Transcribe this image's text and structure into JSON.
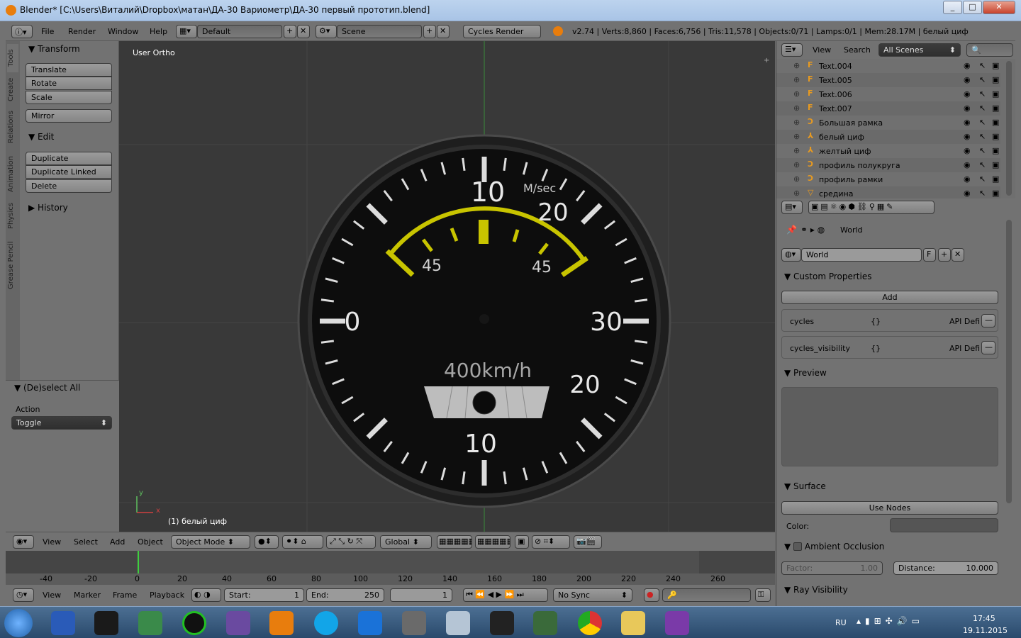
{
  "window": {
    "title": "Blender* [C:\\Users\\Виталий\\Dropbox\\матан\\ДА-30 Вариометр\\ДА-30 первый прототип.blend]",
    "controls": [
      "_",
      "□",
      "✕"
    ]
  },
  "info_header": {
    "menus": [
      "File",
      "Render",
      "Window",
      "Help"
    ],
    "layout": "Default",
    "scene": "Scene",
    "engine": "Cycles Render",
    "stats": "v2.74 | Verts:8,860 | Faces:6,756 | Tris:11,578 | Objects:0/71 | Lamps:0/1 | Mem:28.17M | белый циф"
  },
  "tool_shelf": {
    "tabs": [
      "Tools",
      "Create",
      "Relations",
      "Animation",
      "Physics",
      "Grease Pencil"
    ],
    "transform": {
      "title": "Transform",
      "buttons": [
        "Translate",
        "Rotate",
        "Scale",
        "Mirror"
      ]
    },
    "edit": {
      "title": "Edit",
      "buttons": [
        "Duplicate",
        "Duplicate Linked",
        "Delete"
      ]
    },
    "history": {
      "title": "History"
    },
    "deselect": {
      "title": "(De)select All",
      "action_label": "Action",
      "action_value": "Toggle"
    }
  },
  "viewport": {
    "view_name": "User Ortho",
    "active_object": "(1) белый циф",
    "axis_y": "y",
    "axis_x": "x",
    "gauge": {
      "unit": "M/sec",
      "top_label": "10",
      "upper_right": "20",
      "right": "30",
      "lower_right": "20",
      "bottom": "10",
      "left": "0",
      "yellow_left": "45",
      "yellow_right": "45",
      "speed_label": "400km/h"
    }
  },
  "view3d_header": {
    "menus": [
      "View",
      "Select",
      "Add",
      "Object"
    ],
    "mode": "Object Mode",
    "orientation": "Global"
  },
  "timeline": {
    "ruler": [
      "-40",
      "-20",
      "0",
      "20",
      "40",
      "60",
      "80",
      "100",
      "120",
      "140",
      "160",
      "180",
      "200",
      "220",
      "240",
      "260"
    ],
    "menus": [
      "View",
      "Marker",
      "Frame",
      "Playback"
    ],
    "start_label": "Start:",
    "start_value": "1",
    "end_label": "End:",
    "end_value": "250",
    "current_frame": "1",
    "sync": "No Sync"
  },
  "outliner": {
    "menus": [
      "View",
      "Search"
    ],
    "filter": "All Scenes",
    "items": [
      "Text.004",
      "Text.005",
      "Text.006",
      "Text.007",
      "Большая рамка",
      "белый циф",
      "желтый циф",
      "профиль полукруга",
      "профиль рамки",
      "средина"
    ]
  },
  "properties": {
    "breadcrumb": "World",
    "world_name": "World",
    "world_flag": "F",
    "custom_props": {
      "title": "Custom Properties",
      "add": "Add",
      "rows": [
        {
          "name": "cycles",
          "value": "{}",
          "api": "API Defi"
        },
        {
          "name": "cycles_visibility",
          "value": "{}",
          "api": "API Defi"
        }
      ]
    },
    "preview": {
      "title": "Preview"
    },
    "surface": {
      "title": "Surface",
      "use_nodes": "Use Nodes",
      "color_label": "Color:"
    },
    "ao": {
      "title": "Ambient Occlusion",
      "factor_label": "Factor:",
      "factor_value": "1.00",
      "distance_label": "Distance:",
      "distance_value": "10.000"
    },
    "ray_visibility": {
      "title": "Ray Visibility"
    }
  },
  "taskbar": {
    "lang": "RU",
    "time": "17:45",
    "date": "19.11.2015"
  }
}
